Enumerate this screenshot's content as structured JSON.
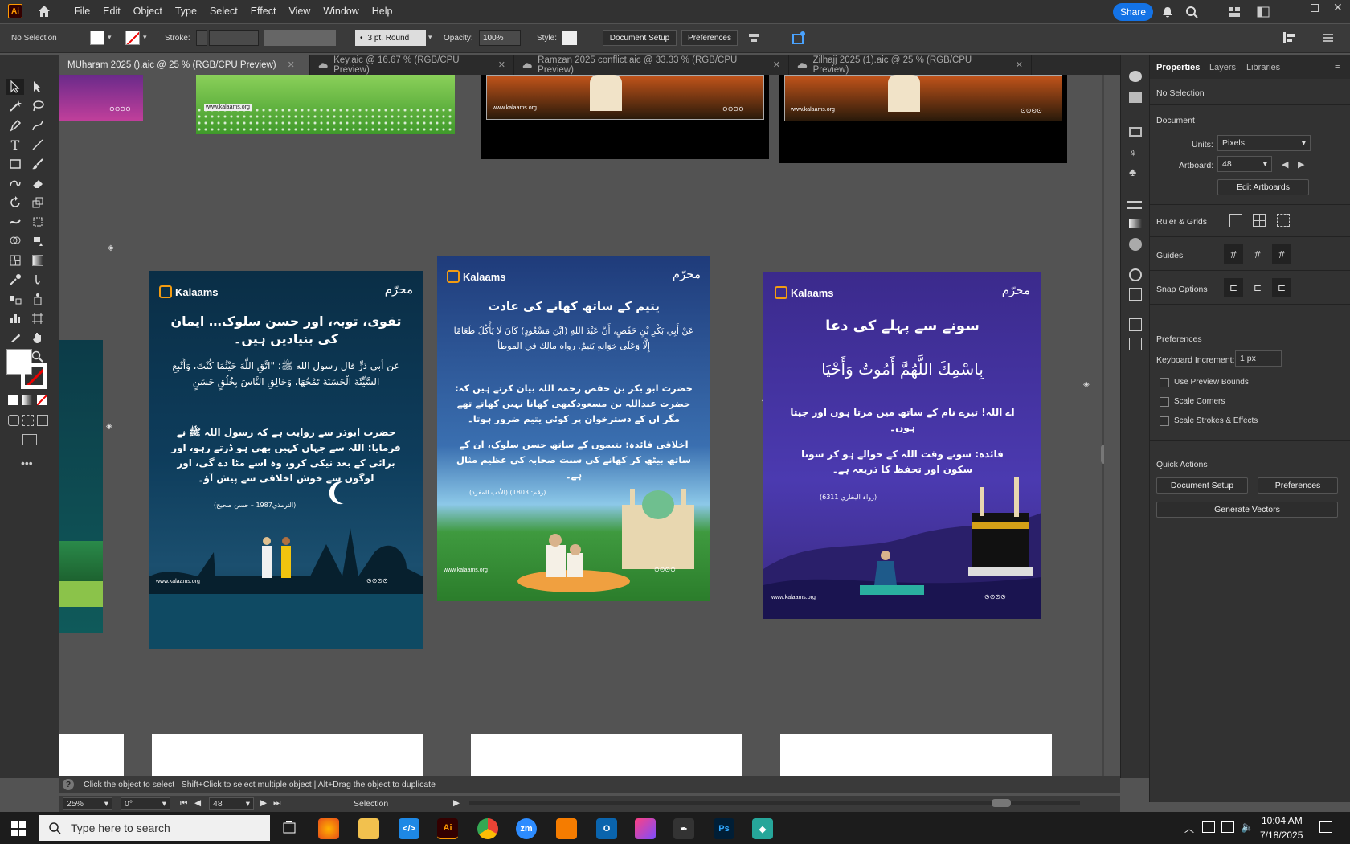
{
  "app": {
    "logo_text": "Ai",
    "menus": [
      "File",
      "Edit",
      "Object",
      "Type",
      "Select",
      "Effect",
      "View",
      "Window",
      "Help"
    ],
    "share_label": "Share"
  },
  "control_bar": {
    "selection": "No Selection",
    "stroke_label": "Stroke:",
    "brush": "3 pt. Round",
    "opacity_label": "Opacity:",
    "opacity_value": "100%",
    "style_label": "Style:",
    "document_setup": "Document Setup",
    "preferences": "Preferences"
  },
  "tabs": [
    {
      "label": "MUharam 2025 ().aic @ 25 % (RGB/CPU Preview)",
      "active": true
    },
    {
      "label": "Key.aic @ 16.67 % (RGB/CPU Preview)",
      "active": false
    },
    {
      "label": "Ramzan 2025 conflict.aic @ 33.33 % (RGB/CPU Preview)",
      "active": false
    },
    {
      "label": "Zilhajj 2025 (1).aic @ 25 % (RGB/CPU Preview)",
      "active": false
    }
  ],
  "panel": {
    "tabs": [
      "Properties",
      "Layers",
      "Libraries"
    ],
    "no_selection": "No Selection",
    "document": "Document",
    "units_label": "Units:",
    "units_value": "Pixels",
    "artboard_label": "Artboard:",
    "artboard_value": "48",
    "edit_artboards": "Edit Artboards",
    "rulers_grids": "Ruler & Grids",
    "guides": "Guides",
    "snap_options": "Snap Options",
    "preferences": "Preferences",
    "keyboard_increment_label": "Keyboard Increment:",
    "keyboard_increment_value": "1 px",
    "use_preview_bounds": "Use Preview Bounds",
    "scale_corners": "Scale Corners",
    "scale_strokes": "Scale Strokes & Effects",
    "quick_actions": "Quick Actions",
    "document_setup": "Document Setup",
    "preferences_btn": "Preferences",
    "generate_vectors": "Generate Vectors"
  },
  "posters": {
    "brand": "Kalaams",
    "website": "www.kalaams.org",
    "p1": {
      "title": "تقوی، توبہ، اور حسن سلوک… ایمان کی بنیادیں ہیں۔",
      "arabic": "عن أبي ذرٍّ قال رسول الله ﷺ: \"اتَّقِ اللَّهَ حَيْثُمَا كُنْتَ، وَأَتْبِعِ السَّيِّئَةَ الْحَسَنَةَ تَمْحُهَا، وَخَالِقِ النَّاسَ بِخُلُقٍ حَسَنٍ",
      "urdu": "حضرت ابوذر سے روایت ہے کہ رسول اللہ ﷺ نے فرمایا: اللہ سے جہاں کہیں بھی ہو ڈرتے رہو، اور برائی کے بعد نیکی کرو، وہ اسے مٹا دے گی، اور لوگوں سے خوش اخلاقی سے پیش آؤ۔",
      "ref": "(الترمذي1987 – حسن صحيح)"
    },
    "p2": {
      "title": "یتیم کے ساتھ کھانے کی عادت",
      "arabic": "عَنْ أَبِي بَكْرِ بْنِ حَفْصٍ، أَنَّ عَبْدَ اللهِ (ابْنَ مَسْعُودٍ) كَانَ لَا يَأْكُلُ طَعَامًا إِلَّا وَعَلَى خِوَانِهِ يَتِيمٌ. رواه مالك في الموطأ",
      "urdu": "حضرت ابو بکر بن حفص رحمہ اللہ بیان کرتے ہیں کہ: حضرت عبداللہ بن مسعودکبھی کھانا نہیں کھاتے تھے مگر ان کے دسترخوان پر کوئی یتیم ضرور ہوتا۔",
      "moral": "اخلاقی فائدہ: یتیموں کے ساتھ حسن سلوک، ان کے ساتھ بیٹھ کر کھانے کی سنت صحابہ کی عظیم مثال ہے۔",
      "ref": "(الأدب المفرد) (رقم: 1803)"
    },
    "p3": {
      "title": "سونے سے پہلے کی دعا",
      "arabic": "بِاسْمِكَ اللَّهُمَّ أَمُوتُ وَأَحْيَا",
      "urdu": "اے اللہ! تیرے نام کے ساتھ میں مرتا ہوں اور جیتا ہوں۔",
      "moral": "فائدہ: سوتے وقت اللہ کے حوالے ہو کر سونا سکون اور تحفظ کا ذریعہ ہے۔",
      "ref": "(رواہ البخاري 6311)"
    }
  },
  "status": {
    "hint": "Click the object to select  |  Shift+Click to select multiple object  |  Alt+Drag the object to duplicate",
    "zoom": "25%",
    "rotation": "0°",
    "artboard": "48",
    "tool": "Selection"
  },
  "taskbar": {
    "search_placeholder": "Type here to search",
    "time": "10:04 AM",
    "date": "7/18/2025"
  },
  "colors": {
    "accent": "#1473e6",
    "ai_orange": "#ff9a00"
  }
}
